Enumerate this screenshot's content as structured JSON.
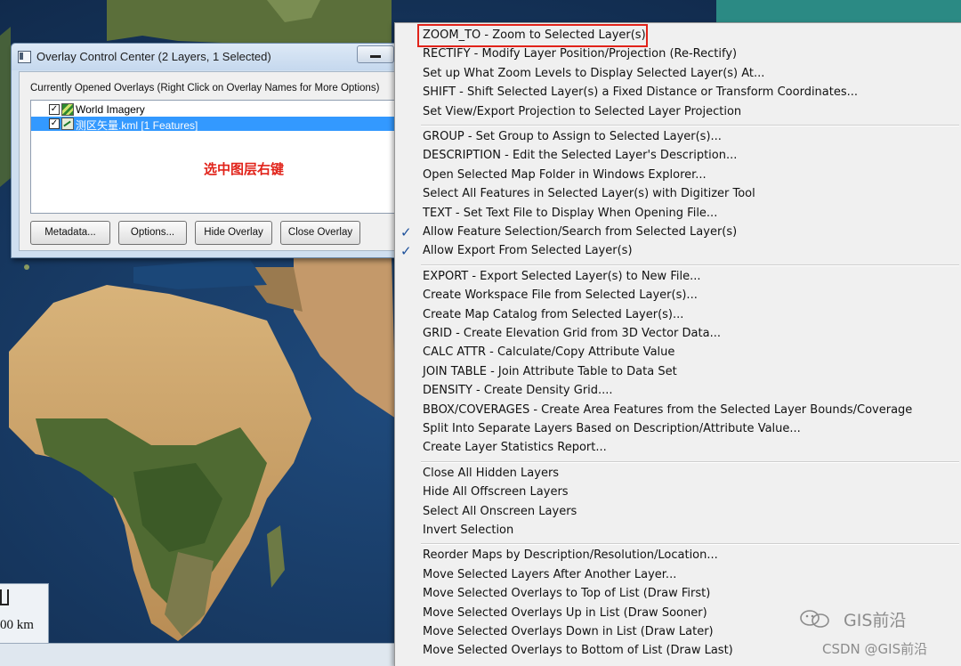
{
  "overlay_window": {
    "title": "Overlay Control Center (2 Layers, 1 Selected)",
    "caption": "Currently Opened Overlays (Right Click on Overlay Names for More Options)",
    "layers": [
      {
        "label": "World Imagery",
        "checked": true,
        "selected": false,
        "icon": "raster-layer-icon"
      },
      {
        "label": "测区矢量.kml [1 Features]",
        "checked": true,
        "selected": true,
        "icon": "vector-layer-icon"
      }
    ],
    "annotation": "选中图层右键",
    "buttons": {
      "metadata": "Metadata...",
      "options": "Options...",
      "hide": "Hide Overlay",
      "close": "Close Overlay"
    }
  },
  "scale_bar": {
    "label": "00 km"
  },
  "context_menu": {
    "groups": [
      [
        {
          "label": "ZOOM_TO - Zoom to Selected Layer(s)",
          "highlighted": true
        },
        {
          "label": "RECTIFY - Modify Layer Position/Projection (Re-Rectify)"
        },
        {
          "label": "Set up What Zoom Levels to Display Selected Layer(s) At..."
        },
        {
          "label": "SHIFT - Shift Selected Layer(s) a Fixed Distance or Transform Coordinates..."
        },
        {
          "label": "Set View/Export Projection to Selected Layer Projection"
        }
      ],
      [
        {
          "label": "GROUP - Set Group to Assign to Selected Layer(s)..."
        },
        {
          "label": "DESCRIPTION - Edit the Selected Layer's Description..."
        },
        {
          "label": "Open Selected Map Folder in Windows Explorer..."
        },
        {
          "label": "Select All Features in Selected Layer(s) with Digitizer Tool"
        },
        {
          "label": "TEXT - Set Text File to Display When Opening File..."
        },
        {
          "label": "Allow Feature Selection/Search from Selected Layer(s)",
          "checked": true
        },
        {
          "label": "Allow Export From Selected Layer(s)",
          "checked": true
        }
      ],
      [
        {
          "label": "EXPORT - Export Selected Layer(s) to New File..."
        },
        {
          "label": "Create Workspace File from Selected Layer(s)..."
        },
        {
          "label": "Create Map Catalog from Selected Layer(s)..."
        },
        {
          "label": "GRID - Create Elevation Grid from 3D Vector Data..."
        },
        {
          "label": "CALC ATTR - Calculate/Copy Attribute Value"
        },
        {
          "label": "JOIN TABLE - Join Attribute Table to Data Set"
        },
        {
          "label": "DENSITY - Create Density Grid...."
        },
        {
          "label": "BBOX/COVERAGES  - Create Area Features from the Selected Layer Bounds/Coverage"
        },
        {
          "label": "Split Into Separate Layers Based on Description/Attribute Value..."
        },
        {
          "label": "Create Layer Statistics Report..."
        }
      ],
      [
        {
          "label": "Close All Hidden Layers"
        },
        {
          "label": "Hide All Offscreen Layers"
        },
        {
          "label": "Select All Onscreen Layers"
        },
        {
          "label": "Invert Selection"
        }
      ],
      [
        {
          "label": "Reorder Maps by Description/Resolution/Location..."
        },
        {
          "label": "Move Selected Layers After Another Layer..."
        },
        {
          "label": "Move Selected Overlays to Top of List (Draw First)"
        },
        {
          "label": "Move Selected Overlays Up in List (Draw Sooner)"
        },
        {
          "label": "Move Selected Overlays Down in List (Draw Later)"
        },
        {
          "label": "Move Selected Overlays to Bottom of List (Draw Last)"
        }
      ]
    ],
    "check_glyph": "✓",
    "highlight_color": "#e1231a"
  },
  "watermark": {
    "line1": "GIS前沿",
    "line2": "CSDN @GIS前沿"
  },
  "colors": {
    "selection": "#3399ff",
    "annotation": "#e1231a",
    "menu_bg": "#f0f0f0"
  }
}
